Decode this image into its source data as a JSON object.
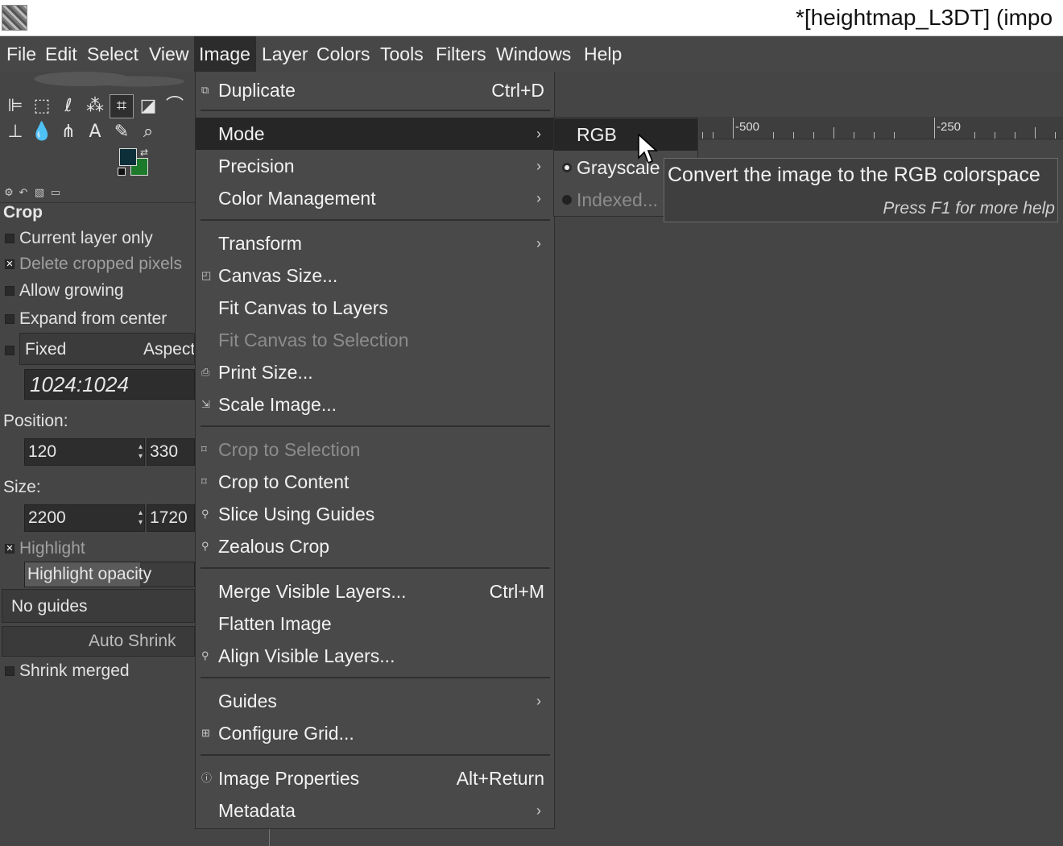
{
  "window": {
    "title": "*[heightmap_L3DT] (impo"
  },
  "menubar": {
    "items": [
      "File",
      "Edit",
      "Select",
      "View",
      "Image",
      "Layer",
      "Colors",
      "Tools",
      "Filters",
      "Windows",
      "Help"
    ],
    "active": "Image"
  },
  "tool_options": {
    "title": "Crop",
    "current_layer_only": "Current layer only",
    "delete_cropped": "Delete cropped pixels",
    "allow_growing": "Allow growing",
    "expand_center": "Expand from center",
    "fixed": "Fixed",
    "aspect": "Aspect",
    "ratio_value": "1024:1024",
    "position_label": "Position:",
    "pos_x": "120",
    "pos_y": "330",
    "size_label": "Size:",
    "size_w": "2200",
    "size_h": "1720",
    "highlight": "Highlight",
    "highlight_opacity": "Highlight opacity",
    "guides_value": "No guides",
    "auto_shrink": "Auto Shrink",
    "shrink_merged": "Shrink merged"
  },
  "image_menu": {
    "duplicate": {
      "label": "Duplicate",
      "accel": "Ctrl+D"
    },
    "mode": "Mode",
    "precision": "Precision",
    "color_management": "Color Management",
    "transform": "Transform",
    "canvas_size": "Canvas Size...",
    "fit_canvas_layers": "Fit Canvas to Layers",
    "fit_canvas_selection": "Fit Canvas to Selection",
    "print_size": "Print Size...",
    "scale_image": "Scale Image...",
    "crop_selection": "Crop to Selection",
    "crop_content": "Crop to Content",
    "slice_guides": "Slice Using Guides",
    "zealous_crop": "Zealous Crop",
    "merge_visible": {
      "label": "Merge Visible Layers...",
      "accel": "Ctrl+M"
    },
    "flatten": "Flatten Image",
    "align_visible": "Align Visible Layers...",
    "guides": "Guides",
    "configure_grid": "Configure Grid...",
    "image_properties": {
      "label": "Image Properties",
      "accel": "Alt+Return"
    },
    "metadata": "Metadata"
  },
  "mode_menu": {
    "rgb": "RGB",
    "grayscale": "Grayscale",
    "indexed": "Indexed..."
  },
  "tooltip": {
    "text": "Convert the image to the RGB colorspace",
    "help": "Press F1 for more help"
  },
  "ruler": {
    "labels": [
      "-500",
      "-250"
    ]
  },
  "colors": {
    "foreground": "#0c2f3a",
    "background": "#1c7a2a",
    "menu_bg": "#494949",
    "highlight": "#262626"
  }
}
